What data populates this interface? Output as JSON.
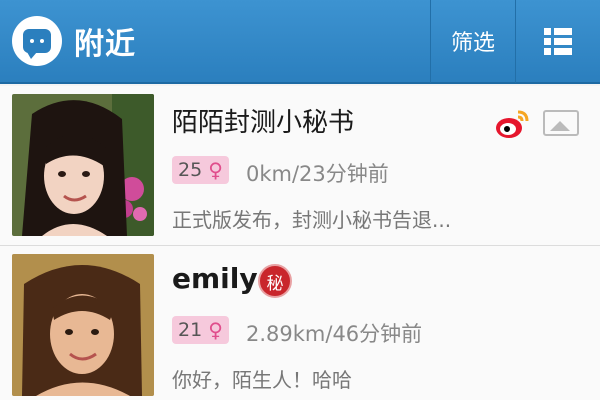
{
  "header": {
    "title": "附近",
    "filter_label": "筛选",
    "logo_icon": "momo-chat-icon",
    "menu_icon": "list-view-icon",
    "bg_color": "#2b7fbe"
  },
  "users": [
    {
      "name": "陌陌封测小秘书",
      "age": "25",
      "gender_symbol": "♀",
      "distance_time": "0km/23分钟前",
      "status": "正式版发布，封测小秘书告退...",
      "icons": [
        "weibo-icon",
        "photo-icon"
      ]
    },
    {
      "name": "emily",
      "badge": "秘",
      "age": "21",
      "gender_symbol": "♀",
      "distance_time": "2.89km/46分钟前",
      "status": "你好，陌生人！哈哈"
    }
  ]
}
